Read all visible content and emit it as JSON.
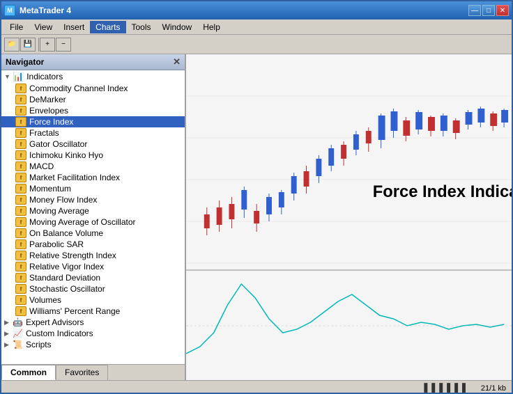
{
  "titleBar": {
    "title": "MetaTrader 4",
    "controls": {
      "minimize": "—",
      "maximize": "□",
      "close": "✕"
    }
  },
  "menuBar": {
    "items": [
      "File",
      "View",
      "Insert",
      "Charts",
      "Tools",
      "Window",
      "Help"
    ]
  },
  "navigator": {
    "title": "Navigator",
    "sections": [
      {
        "name": "indicators",
        "items": [
          "Commodity Channel Index",
          "DeMarker",
          "Envelopes",
          "Force Index",
          "Fractals",
          "Gator Oscillator",
          "Ichimoku Kinko Hyo",
          "MACD",
          "Market Facilitation Index",
          "Momentum",
          "Money Flow Index",
          "Moving Average",
          "Moving Average of Oscillator",
          "On Balance Volume",
          "Parabolic SAR",
          "Relative Strength Index",
          "Relative Vigor Index",
          "Standard Deviation",
          "Stochastic Oscillator",
          "Volumes",
          "Williams' Percent Range"
        ]
      },
      {
        "name": "expertAdvisors",
        "label": "Expert Advisors"
      },
      {
        "name": "customIndicators",
        "label": "Custom Indicators"
      },
      {
        "name": "scripts",
        "label": "Scripts"
      }
    ],
    "tabs": [
      "Common",
      "Favorites"
    ]
  },
  "chart": {
    "title": "Force Index Indicator",
    "statusBar": {
      "barIcon": "▌▌▌▌▌▌",
      "info": "21/1 kb"
    }
  }
}
